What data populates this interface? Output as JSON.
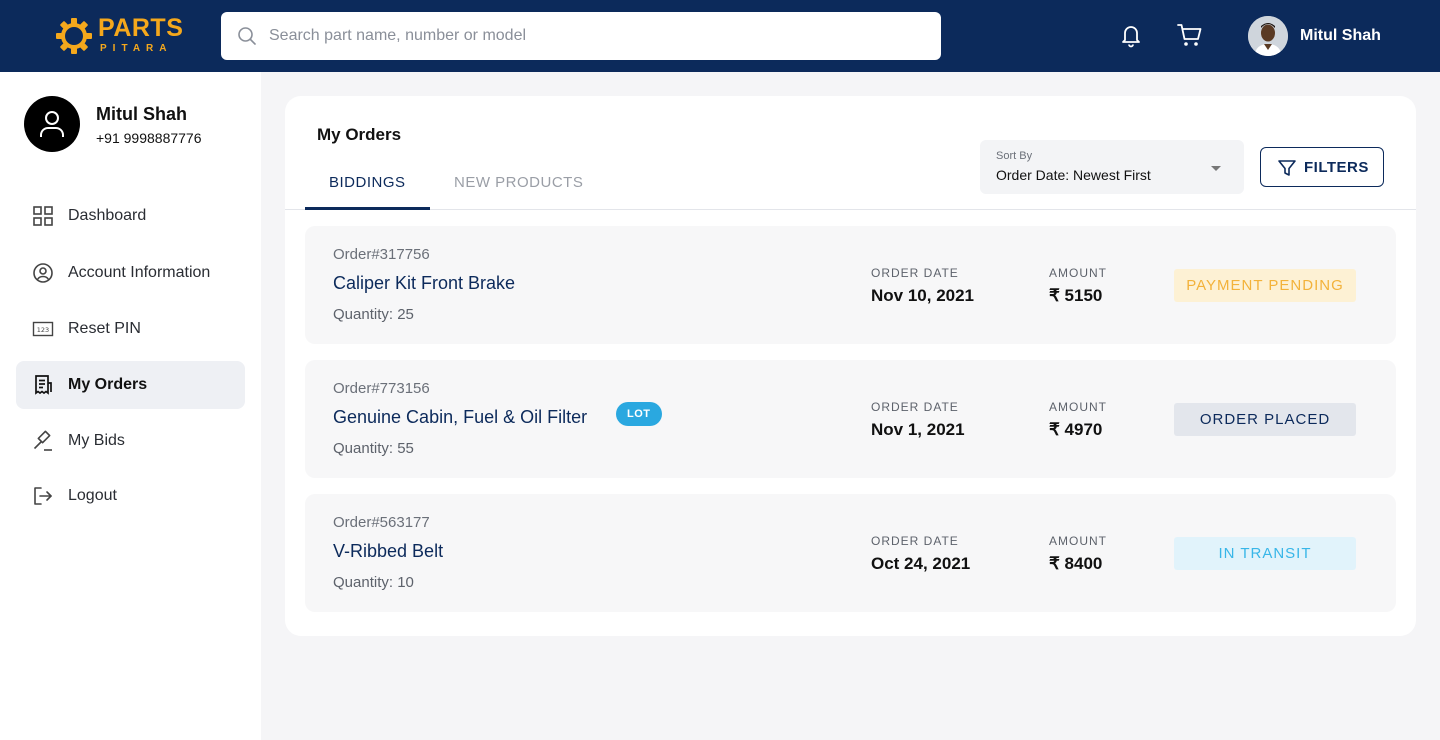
{
  "brand": {
    "logo_main": "PARTS",
    "logo_sub": "PITARA",
    "accent": "#f5a81c",
    "navy": "#0c2a5b"
  },
  "header": {
    "search_placeholder": "Search part name, number or model",
    "icons": [
      "bell-icon",
      "cart-icon"
    ],
    "user_name": "Mitul Shah"
  },
  "profile": {
    "name": "Mitul Shah",
    "phone": "+91 9998887776"
  },
  "sidebar": {
    "items": [
      {
        "label": "Dashboard",
        "icon": "grid-icon",
        "active": false
      },
      {
        "label": "Account Information",
        "icon": "user-circle-icon",
        "active": false
      },
      {
        "label": "Reset PIN",
        "icon": "pin-123-icon",
        "active": false
      },
      {
        "label": "My Orders",
        "icon": "receipt-icon",
        "active": true
      },
      {
        "label": "My Bids",
        "icon": "gavel-icon",
        "active": false
      },
      {
        "label": "Logout",
        "icon": "logout-icon",
        "active": false
      }
    ]
  },
  "main": {
    "title": "My Orders",
    "tabs": [
      {
        "label": "BIDDINGS",
        "active": true
      },
      {
        "label": "NEW PRODUCTS",
        "active": false
      }
    ],
    "sort": {
      "label": "Sort By",
      "value": "Order Date: Newest First"
    },
    "filters_label": "FILTERS",
    "col_date_label": "ORDER DATE",
    "col_amount_label": "AMOUNT",
    "orders": [
      {
        "order_no": "Order#317756",
        "name": "Caliper Kit Front Brake",
        "badge": "",
        "quantity": "Quantity: 25",
        "date": "Nov 10, 2021",
        "amount": "₹ 5150",
        "status": "PAYMENT PENDING",
        "status_bg": "#fdf1d4",
        "status_fg": "#f3b23a"
      },
      {
        "order_no": "Order#773156",
        "name": "Genuine Cabin, Fuel & Oil Filter",
        "badge": "LOT",
        "quantity": "Quantity: 55",
        "date": "Nov 1, 2021",
        "amount": "₹ 4970",
        "status": "ORDER PLACED",
        "status_bg": "#e3e6ec",
        "status_fg": "#0c2a5b"
      },
      {
        "order_no": "Order#563177",
        "name": "V-Ribbed Belt",
        "badge": "",
        "quantity": "Quantity: 10",
        "date": "Oct 24, 2021",
        "amount": "₹ 8400",
        "status": "IN TRANSIT",
        "status_bg": "#e1f3fb",
        "status_fg": "#38b6e8"
      }
    ]
  }
}
